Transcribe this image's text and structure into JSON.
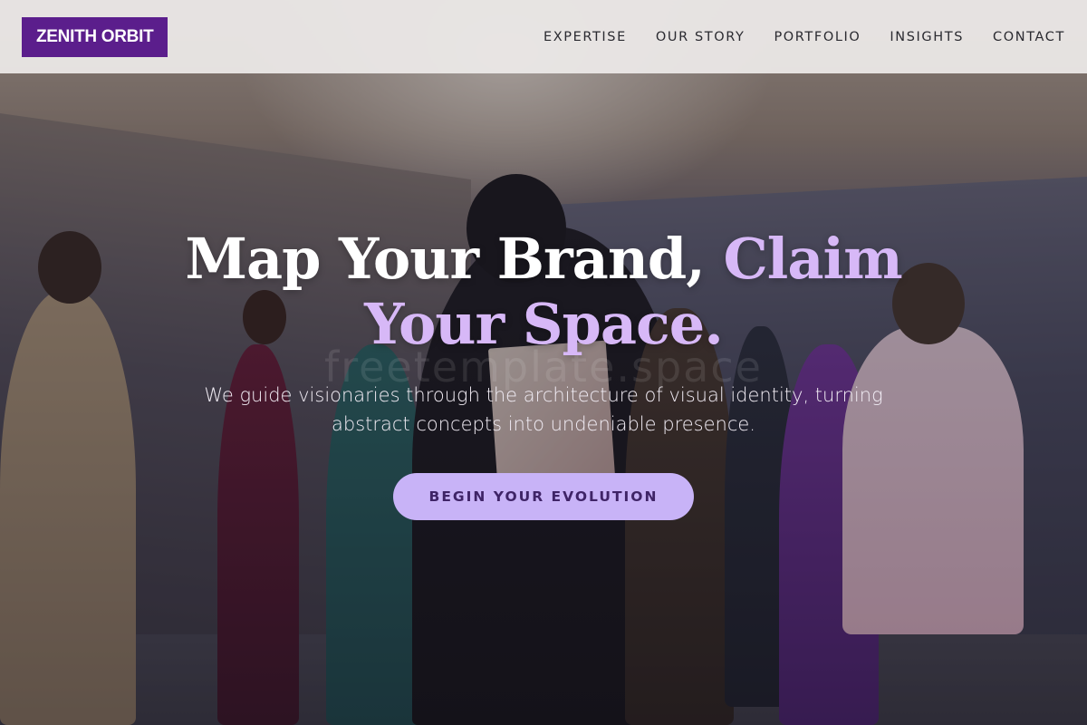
{
  "header": {
    "logo": "ZENITH ORBIT",
    "nav": [
      {
        "label": "EXPERTISE"
      },
      {
        "label": "OUR STORY"
      },
      {
        "label": "PORTFOLIO"
      },
      {
        "label": "INSIGHTS"
      },
      {
        "label": "CONTACT"
      }
    ]
  },
  "hero": {
    "title_part1": "Map Your Brand, ",
    "title_accent": "Claim Your Space.",
    "subtitle": "We guide visionaries through the architecture of visual identity, turning abstract concepts into undeniable presence.",
    "cta_label": "BEGIN YOUR EVOLUTION",
    "watermark": "freetemplate.space"
  },
  "colors": {
    "brand": "#5b1e8c",
    "accent": "#d7b8f7",
    "cta_bg": "#c8b3f7",
    "cta_text": "#3f2467"
  }
}
